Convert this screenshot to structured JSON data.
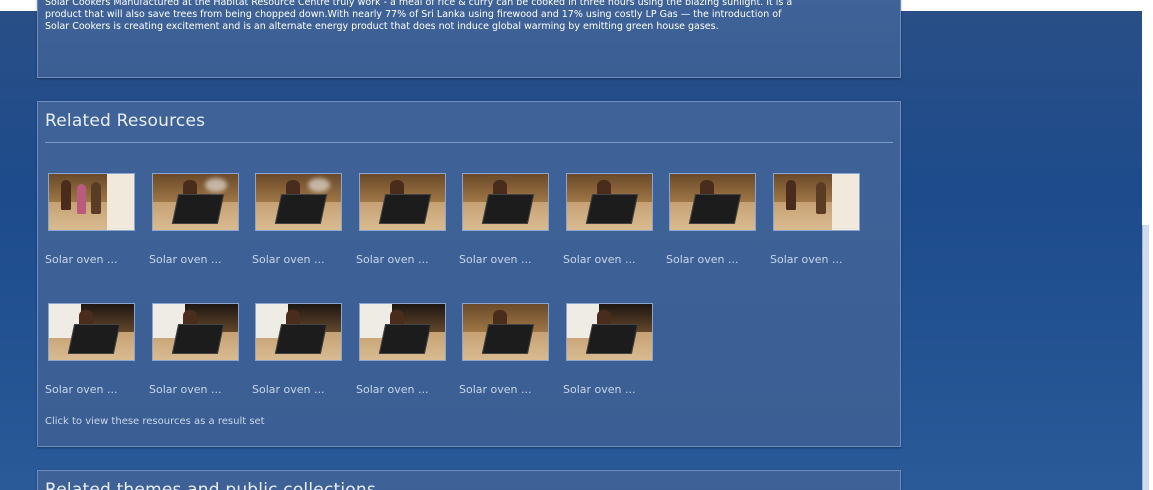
{
  "description": {
    "lines": [
      "Solar Cookers Manufactured at the Habitat Resource Centre truly work - a meal of rice & curry can be cooked in three hours using the blazing sunlight. It is a",
      "product that will also save trees from being chopped down.With nearly 77% of Sri Lanka using firewood and 17% using costly LP Gas — the introduction of",
      "Solar Cookers is creating excitement and is an alternate energy product that does not induce global warming by emitting green house gases."
    ]
  },
  "related": {
    "title": "Related Resources",
    "items": [
      {
        "caption": "Solar oven ..."
      },
      {
        "caption": "Solar oven ..."
      },
      {
        "caption": "Solar oven ..."
      },
      {
        "caption": "Solar oven ..."
      },
      {
        "caption": "Solar oven ..."
      },
      {
        "caption": "Solar oven ..."
      },
      {
        "caption": "Solar oven ..."
      },
      {
        "caption": "Solar oven ..."
      },
      {
        "caption": "Solar oven ..."
      },
      {
        "caption": "Solar oven ..."
      },
      {
        "caption": "Solar oven ..."
      },
      {
        "caption": "Solar oven ..."
      },
      {
        "caption": "Solar oven ..."
      },
      {
        "caption": "Solar oven ..."
      }
    ],
    "result_link": "Click to view these resources as a result set"
  },
  "themes": {
    "title": "Related themes and public collections"
  }
}
